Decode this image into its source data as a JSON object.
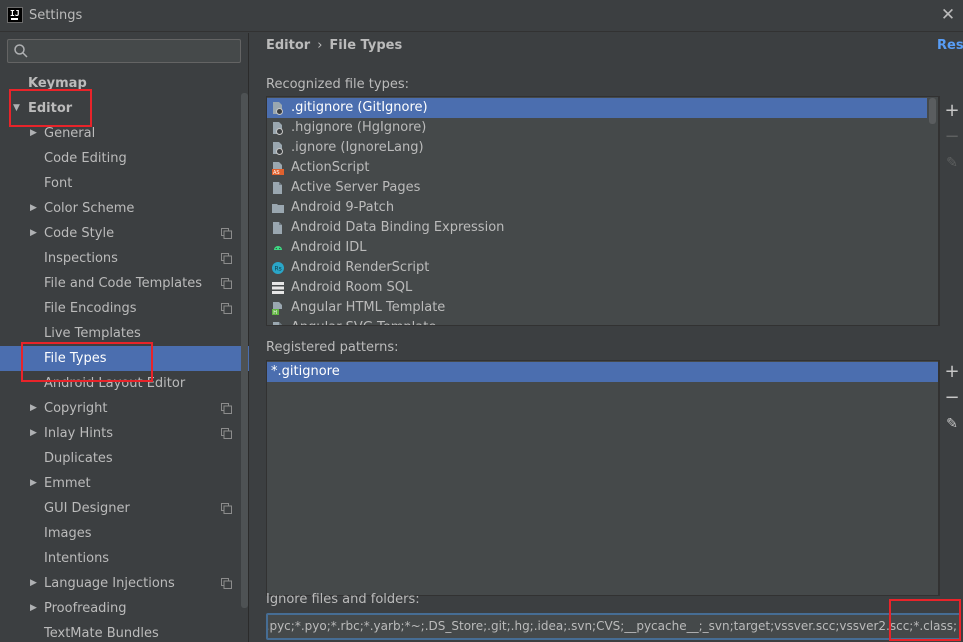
{
  "window": {
    "title": "Settings"
  },
  "search": {
    "placeholder": ""
  },
  "sidebar": {
    "items": [
      {
        "label": "Keymap",
        "level": 0,
        "arrow": "",
        "bold": true,
        "selected": false,
        "project": false
      },
      {
        "label": "Editor",
        "level": 0,
        "arrow": "down",
        "bold": true,
        "selected": false,
        "project": false
      },
      {
        "label": "General",
        "level": 1,
        "arrow": "right",
        "bold": false,
        "selected": false,
        "project": false
      },
      {
        "label": "Code Editing",
        "level": 1,
        "arrow": "",
        "bold": false,
        "selected": false,
        "project": false
      },
      {
        "label": "Font",
        "level": 1,
        "arrow": "",
        "bold": false,
        "selected": false,
        "project": false
      },
      {
        "label": "Color Scheme",
        "level": 1,
        "arrow": "right",
        "bold": false,
        "selected": false,
        "project": false
      },
      {
        "label": "Code Style",
        "level": 1,
        "arrow": "right",
        "bold": false,
        "selected": false,
        "project": true
      },
      {
        "label": "Inspections",
        "level": 1,
        "arrow": "",
        "bold": false,
        "selected": false,
        "project": true
      },
      {
        "label": "File and Code Templates",
        "level": 1,
        "arrow": "",
        "bold": false,
        "selected": false,
        "project": true
      },
      {
        "label": "File Encodings",
        "level": 1,
        "arrow": "",
        "bold": false,
        "selected": false,
        "project": true
      },
      {
        "label": "Live Templates",
        "level": 1,
        "arrow": "",
        "bold": false,
        "selected": false,
        "project": false
      },
      {
        "label": "File Types",
        "level": 1,
        "arrow": "",
        "bold": false,
        "selected": true,
        "project": false
      },
      {
        "label": "Android Layout Editor",
        "level": 1,
        "arrow": "",
        "bold": false,
        "selected": false,
        "project": false
      },
      {
        "label": "Copyright",
        "level": 1,
        "arrow": "right",
        "bold": false,
        "selected": false,
        "project": true
      },
      {
        "label": "Inlay Hints",
        "level": 1,
        "arrow": "right",
        "bold": false,
        "selected": false,
        "project": true
      },
      {
        "label": "Duplicates",
        "level": 1,
        "arrow": "",
        "bold": false,
        "selected": false,
        "project": false
      },
      {
        "label": "Emmet",
        "level": 1,
        "arrow": "right",
        "bold": false,
        "selected": false,
        "project": false
      },
      {
        "label": "GUI Designer",
        "level": 1,
        "arrow": "",
        "bold": false,
        "selected": false,
        "project": true
      },
      {
        "label": "Images",
        "level": 1,
        "arrow": "",
        "bold": false,
        "selected": false,
        "project": false
      },
      {
        "label": "Intentions",
        "level": 1,
        "arrow": "",
        "bold": false,
        "selected": false,
        "project": false
      },
      {
        "label": "Language Injections",
        "level": 1,
        "arrow": "right",
        "bold": false,
        "selected": false,
        "project": true
      },
      {
        "label": "Proofreading",
        "level": 1,
        "arrow": "right",
        "bold": false,
        "selected": false,
        "project": false
      },
      {
        "label": "TextMate Bundles",
        "level": 1,
        "arrow": "",
        "bold": false,
        "selected": false,
        "project": false
      }
    ]
  },
  "breadcrumb": {
    "parent": "Editor",
    "separator": "›",
    "current": "File Types"
  },
  "reset_label": "Rese",
  "recognized": {
    "label": "Recognized file types:",
    "items": [
      {
        "label": ".gitignore (GitIgnore)",
        "icon": "ignore-file-icon",
        "selected": true
      },
      {
        "label": ".hgignore (HgIgnore)",
        "icon": "ignore-file-icon",
        "selected": false
      },
      {
        "label": ".ignore (IgnoreLang)",
        "icon": "ignore-file-icon",
        "selected": false
      },
      {
        "label": "ActionScript",
        "icon": "actionscript-icon",
        "selected": false
      },
      {
        "label": "Active Server Pages",
        "icon": "file-icon",
        "selected": false
      },
      {
        "label": "Android 9-Patch",
        "icon": "folder-icon",
        "selected": false
      },
      {
        "label": "Android Data Binding Expression",
        "icon": "file-icon",
        "selected": false
      },
      {
        "label": "Android IDL",
        "icon": "android-icon",
        "selected": false
      },
      {
        "label": "Android RenderScript",
        "icon": "renderscript-icon",
        "selected": false
      },
      {
        "label": "Android Room SQL",
        "icon": "sql-icon",
        "selected": false
      },
      {
        "label": "Angular HTML Template",
        "icon": "angular-html-icon",
        "selected": false
      },
      {
        "label": "Angular SVG Template",
        "icon": "file-icon",
        "selected": false
      }
    ]
  },
  "patterns": {
    "label": "Registered patterns:",
    "items": [
      {
        "label": "*.gitignore",
        "selected": true
      }
    ]
  },
  "ignore": {
    "label": "Ignore files and folders:",
    "value": "*.hprof;*.iml;*.pyc;*.pyo;*.rbc;*.yarb;*~;.DS_Store;.git;.hg;.idea;.svn;CVS;__pycache__;_svn;target;vssver.scc;vssver2.scc;*.class;"
  },
  "tools": {
    "add": "+",
    "remove": "−",
    "edit": "✎"
  },
  "colors": {
    "selection": "#4b6eaf",
    "annotation": "#e8242a",
    "link": "#589df6"
  }
}
